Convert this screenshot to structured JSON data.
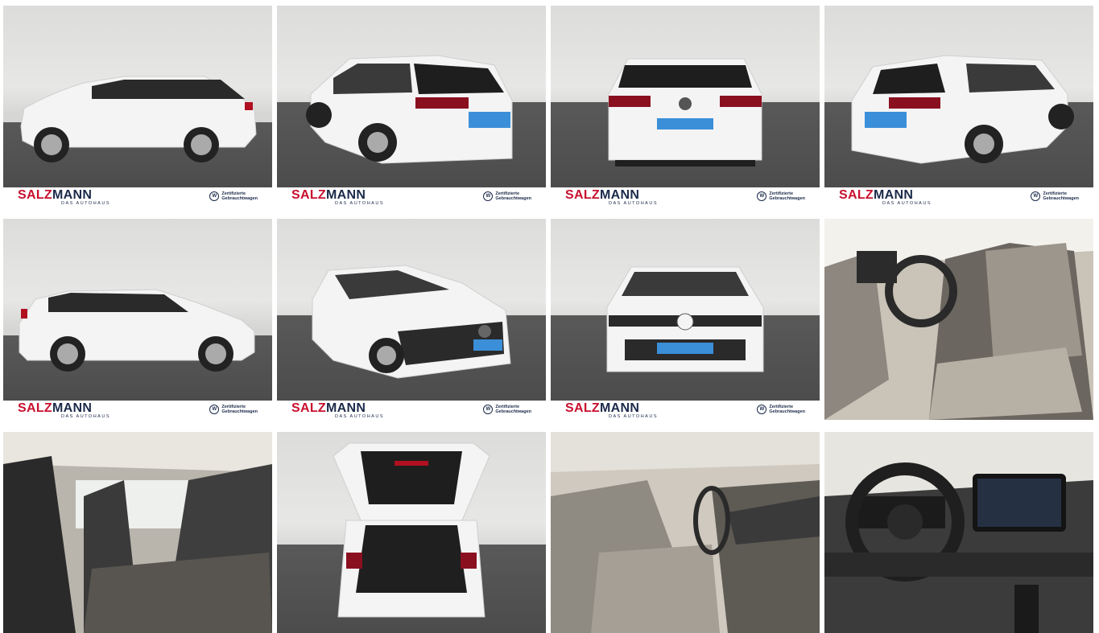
{
  "gallery": {
    "brand": {
      "name_part1": "SALZ",
      "name_part2": "MANN",
      "tagline": "Das Autohaus",
      "cert_line1": "Zertifizierte",
      "cert_line2": "Gebrauchtwagen",
      "vw_icon": "vw-logo-icon"
    },
    "photos": [
      {
        "view": "side-left",
        "icon": "car-side-left"
      },
      {
        "view": "rear-left-angle",
        "icon": "car-rear-angle"
      },
      {
        "view": "rear",
        "icon": "car-rear"
      },
      {
        "view": "rear-right-angle",
        "icon": "car-rear-angle"
      },
      {
        "view": "side-right",
        "icon": "car-side-right"
      },
      {
        "view": "front-left-angle",
        "icon": "car-front-angle"
      },
      {
        "view": "front",
        "icon": "car-front"
      },
      {
        "view": "interior-front-seats",
        "icon": "seat"
      },
      {
        "view": "interior-rear-seats",
        "icon": "seat"
      },
      {
        "view": "trunk-open",
        "icon": "trunk"
      },
      {
        "view": "interior-passenger",
        "icon": "dashboard"
      },
      {
        "view": "cockpit",
        "icon": "steering-wheel"
      }
    ],
    "colors": {
      "brand_red": "#c8102e",
      "brand_navy": "#1b2a4a",
      "car_white": "#f4f4f4",
      "floor": "#4f4f4f"
    }
  }
}
